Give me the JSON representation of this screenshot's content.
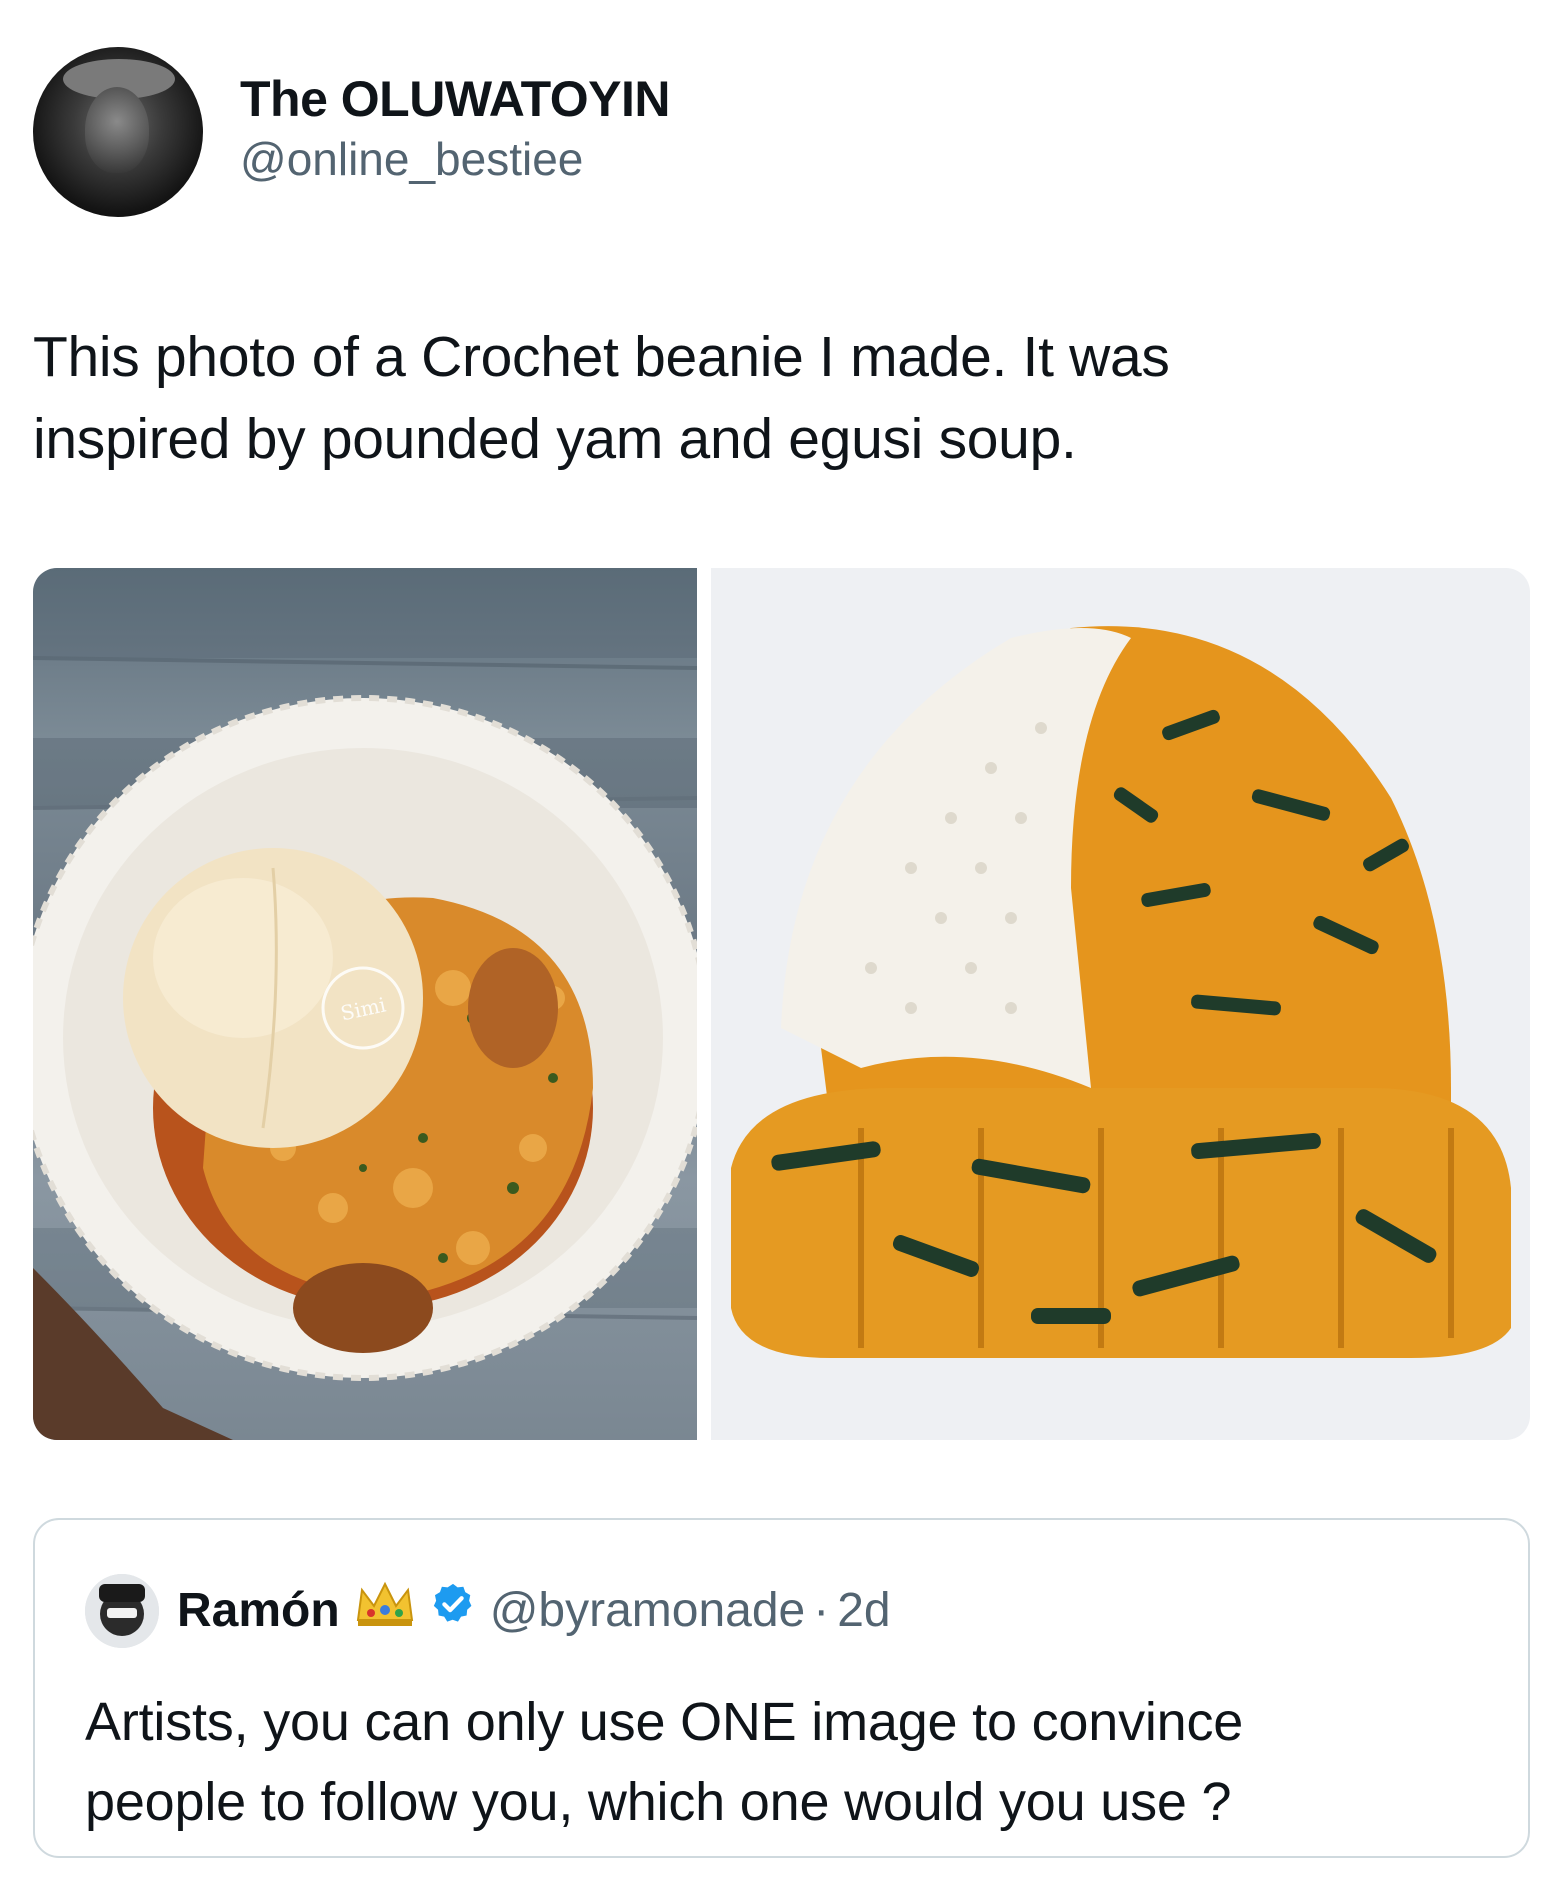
{
  "tweet": {
    "display_name": "The OLUWATOYIN",
    "handle": "@online_bestiee",
    "text_line_1": "This photo of a Crochet beanie I made. It was",
    "text_line_2": "inspired by pounded yam and egusi soup."
  },
  "media": {
    "left_image_icon": "pounded-yam-egusi-photo",
    "left_watermark": "Simi",
    "right_image_icon": "crochet-beanie-photo"
  },
  "quoted_tweet": {
    "display_name": "Ramón",
    "crown_icon": "crown-emoji",
    "verified_icon": "verified-badge-icon",
    "handle": "@byramonade",
    "separator": "·",
    "time": "2d",
    "text_line_1": "Artists, you can only use ONE image to convince",
    "text_line_2": "people to follow you, which one would you use ?"
  },
  "colors": {
    "text_primary": "#0f1419",
    "text_secondary": "#536471",
    "border": "#cfd9de",
    "verified": "#1d9bf0"
  }
}
